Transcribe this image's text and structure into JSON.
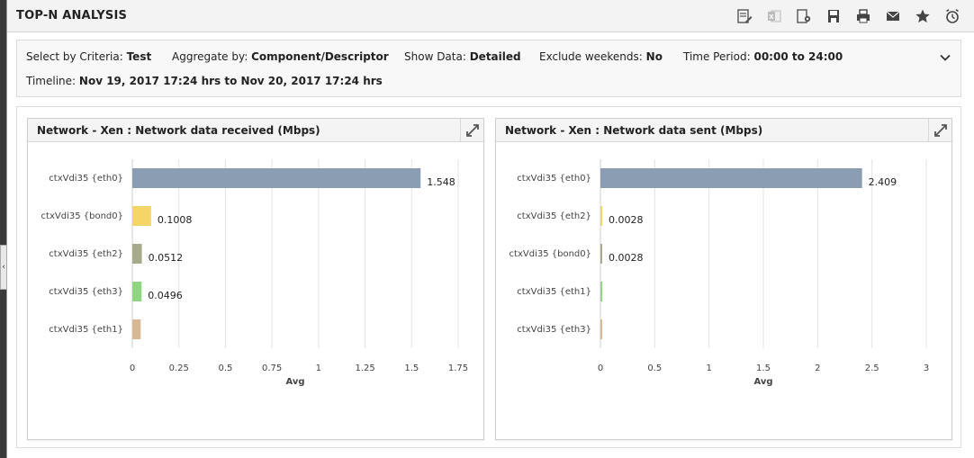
{
  "page": {
    "title": "TOP-N ANALYSIS"
  },
  "toolbar": {
    "icons": [
      "report-edit-icon",
      "excel-export-icon",
      "report-settings-icon",
      "save-icon",
      "print-icon",
      "email-icon",
      "favorite-star-icon",
      "alarm-clock-icon"
    ]
  },
  "criteria": {
    "select_label": "Select by Criteria:",
    "select_value": "Test",
    "aggregate_label": "Aggregate by:",
    "aggregate_value": "Component/Descriptor",
    "show_label": "Show Data:",
    "show_value": "Detailed",
    "exclude_label": "Exclude weekends:",
    "exclude_value": "No",
    "period_label": "Time Period:",
    "period_value": "00:00 to 24:00",
    "timeline_label": "Timeline:",
    "timeline_value": "Nov 19, 2017 17:24 hrs to Nov 20, 2017 17:24 hrs"
  },
  "chart_data": [
    {
      "type": "bar",
      "orientation": "horizontal",
      "title": "Network - Xen : Network data received (Mbps)",
      "xlabel": "Avg",
      "ylabel": "",
      "categories": [
        "ctxVdi35 {eth0}",
        "ctxVdi35 {bond0}",
        "ctxVdi35 {eth2}",
        "ctxVdi35 {eth3}",
        "ctxVdi35 {eth1}"
      ],
      "values": [
        1.548,
        0.1008,
        0.0512,
        0.0496,
        0.045
      ],
      "value_labels": [
        "1.548",
        "0.1008",
        "0.0512",
        "0.0496",
        ""
      ],
      "colors": [
        "#8a9db3",
        "#f5d565",
        "#a7ab8c",
        "#8ed67f",
        "#d8b894"
      ],
      "xlim": [
        0,
        1.75
      ],
      "xticks": [
        0,
        0.25,
        0.5,
        0.75,
        1,
        1.25,
        1.5,
        1.75
      ],
      "xtick_labels": [
        "0",
        "0.25",
        "0.5",
        "0.75",
        "1",
        "1.25",
        "1.5",
        "1.75"
      ],
      "grid": true
    },
    {
      "type": "bar",
      "orientation": "horizontal",
      "title": "Network - Xen : Network data sent (Mbps)",
      "xlabel": "Avg",
      "ylabel": "",
      "categories": [
        "ctxVdi35 {eth0}",
        "ctxVdi35 {eth2}",
        "ctxVdi35 {bond0}",
        "ctxVdi35 {eth1}",
        "ctxVdi35 {eth3}"
      ],
      "values": [
        2.409,
        0.0028,
        0.0028,
        0.002,
        0.002
      ],
      "value_labels": [
        "2.409",
        "0.0028",
        "0.0028",
        "",
        ""
      ],
      "colors": [
        "#8a9db3",
        "#f5d565",
        "#a7ab8c",
        "#8ed67f",
        "#d8b894"
      ],
      "xlim": [
        0,
        3
      ],
      "xticks": [
        0,
        0.5,
        1,
        1.5,
        2,
        2.5,
        3
      ],
      "xtick_labels": [
        "0",
        "0.5",
        "1",
        "1.5",
        "2",
        "2.5",
        "3"
      ],
      "grid": true
    }
  ]
}
